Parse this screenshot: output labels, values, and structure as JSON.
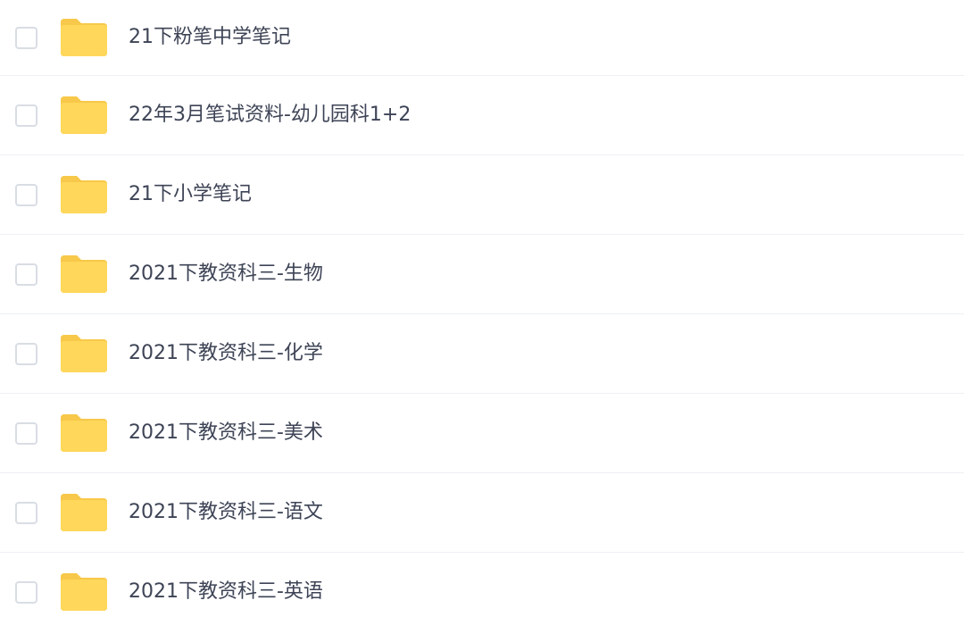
{
  "file_list": {
    "items": [
      {
        "name": "21下粉笔中学笔记",
        "type": "folder",
        "icon": "folder-icon",
        "checked": false
      },
      {
        "name": "22年3月笔试资料-幼儿园科1+2",
        "type": "folder",
        "icon": "folder-icon",
        "checked": false
      },
      {
        "name": "21下小学笔记",
        "type": "folder",
        "icon": "folder-icon",
        "checked": false
      },
      {
        "name": "2021下教资科三-生物",
        "type": "folder",
        "icon": "folder-icon",
        "checked": false
      },
      {
        "name": "2021下教资科三-化学",
        "type": "folder",
        "icon": "folder-icon",
        "checked": false
      },
      {
        "name": "2021下教资科三-美术",
        "type": "folder",
        "icon": "folder-icon",
        "checked": false
      },
      {
        "name": "2021下教资科三-语文",
        "type": "folder",
        "icon": "folder-icon",
        "checked": false
      },
      {
        "name": "2021下教资科三-英语",
        "type": "folder",
        "icon": "folder-icon",
        "checked": false
      }
    ]
  },
  "colors": {
    "folder_fill": "#ffd75a",
    "folder_tab": "#f7c84a",
    "checkbox_border": "#d9dde4",
    "text": "#3e4456",
    "divider": "#eef0f4"
  }
}
